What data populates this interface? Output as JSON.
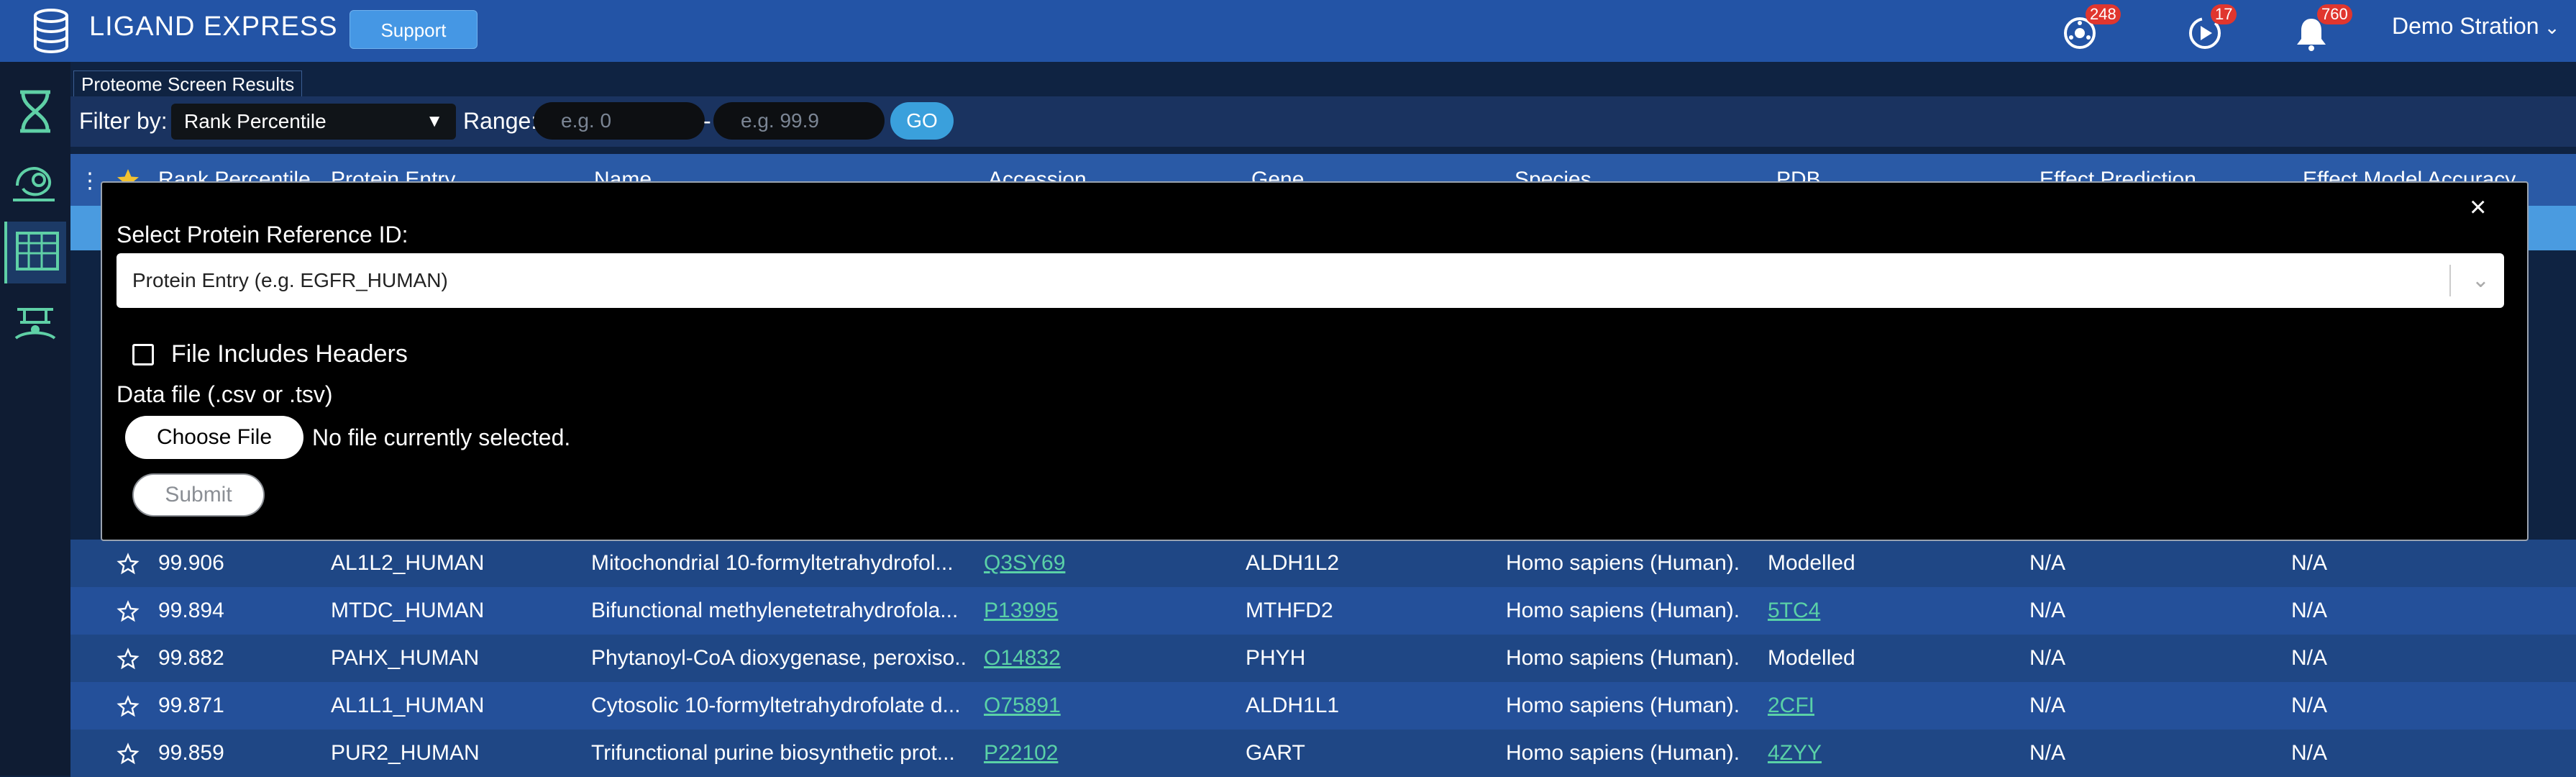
{
  "header": {
    "app_title": "LIGAND EXPRESS",
    "support_label": "Support",
    "notif_1_count": "248",
    "notif_2_count": "17",
    "notif_3_count": "760",
    "user_name": "Demo Stration"
  },
  "sidebar": {
    "items": [
      {
        "icon": "dna-icon"
      },
      {
        "icon": "protein-icon"
      },
      {
        "icon": "table-grid-icon",
        "active": true
      },
      {
        "icon": "binding-icon"
      }
    ]
  },
  "results": {
    "tab_label": "Proteome Screen Results",
    "filter_label": "Filter by:",
    "filter_value": "Rank Percentile",
    "range_label": "Range:",
    "range_min_placeholder": "e.g. 0",
    "range_sep": "-",
    "range_max_placeholder": "e.g. 99.9",
    "go_label": "GO"
  },
  "table": {
    "columns": [
      "Rank Percentile",
      "Protein Entry",
      "Name",
      "Accession",
      "Gene",
      "Species",
      "PDB",
      "Effect Prediction",
      "Effect Model Accuracy"
    ],
    "rows": [
      {
        "rank": "99.906",
        "entry": "AL1L2_HUMAN",
        "name": "Mitochondrial 10-formyltetrahydrofol...",
        "accession": "Q3SY69",
        "gene": "ALDH1L2",
        "species": "Homo sapiens (Human).",
        "pdb": "Modelled",
        "effect": "N/A",
        "accuracy": "N/A"
      },
      {
        "rank": "99.894",
        "entry": "MTDC_HUMAN",
        "name": "Bifunctional methylenetetrahydrofola...",
        "accession": "P13995",
        "gene": "MTHFD2",
        "species": "Homo sapiens (Human).",
        "pdb": "5TC4",
        "effect": "N/A",
        "accuracy": "N/A"
      },
      {
        "rank": "99.882",
        "entry": "PAHX_HUMAN",
        "name": "Phytanoyl-CoA dioxygenase, peroxiso...",
        "accession": "O14832",
        "gene": "PHYH",
        "species": "Homo sapiens (Human).",
        "pdb": "Modelled",
        "effect": "N/A",
        "accuracy": "N/A"
      },
      {
        "rank": "99.871",
        "entry": "AL1L1_HUMAN",
        "name": "Cytosolic 10-formyltetrahydrofolate d...",
        "accession": "O75891",
        "gene": "ALDH1L1",
        "species": "Homo sapiens (Human).",
        "pdb": "2CFI",
        "effect": "N/A",
        "accuracy": "N/A"
      },
      {
        "rank": "99.859",
        "entry": "PUR2_HUMAN",
        "name": "Trifunctional purine biosynthetic prot...",
        "accession": "P22102",
        "gene": "GART",
        "species": "Homo sapiens (Human).",
        "pdb": "4ZYY",
        "effect": "N/A",
        "accuracy": "N/A"
      }
    ]
  },
  "modal": {
    "close_label": "×",
    "select_label": "Select Protein Reference ID:",
    "select_value": "Protein Entry (e.g. EGFR_HUMAN)",
    "checkbox_label": "File Includes Headers",
    "datafile_label": "Data file (.csv or .tsv)",
    "choose_label": "Choose File",
    "file_status": "No file currently selected.",
    "submit_label": "Submit"
  },
  "colors": {
    "topbar": "#2354a6",
    "link": "#5ad1a7",
    "badge": "#e0362e",
    "go_button": "#3aa0dc"
  }
}
